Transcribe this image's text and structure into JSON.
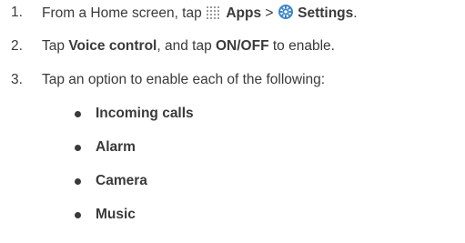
{
  "steps": [
    {
      "num": "1.",
      "part1": "From a Home screen, tap",
      "apps_icon": "apps-grid-icon",
      "apps_label": "Apps",
      "sep": ">",
      "settings_icon": "settings-gear-icon",
      "settings_label": "Settings",
      "end": "."
    },
    {
      "num": "2.",
      "part1": "Tap",
      "bold1": "Voice control",
      "part2": ", and tap",
      "bold2": "ON/OFF",
      "part3": "to enable."
    },
    {
      "num": "3.",
      "text": "Tap an option to enable each of the following:"
    }
  ],
  "options": [
    "Incoming calls",
    "Alarm",
    "Camera",
    "Music"
  ],
  "colors": {
    "text": "#3a3a3a",
    "settings_icon": "#3a86c8"
  }
}
